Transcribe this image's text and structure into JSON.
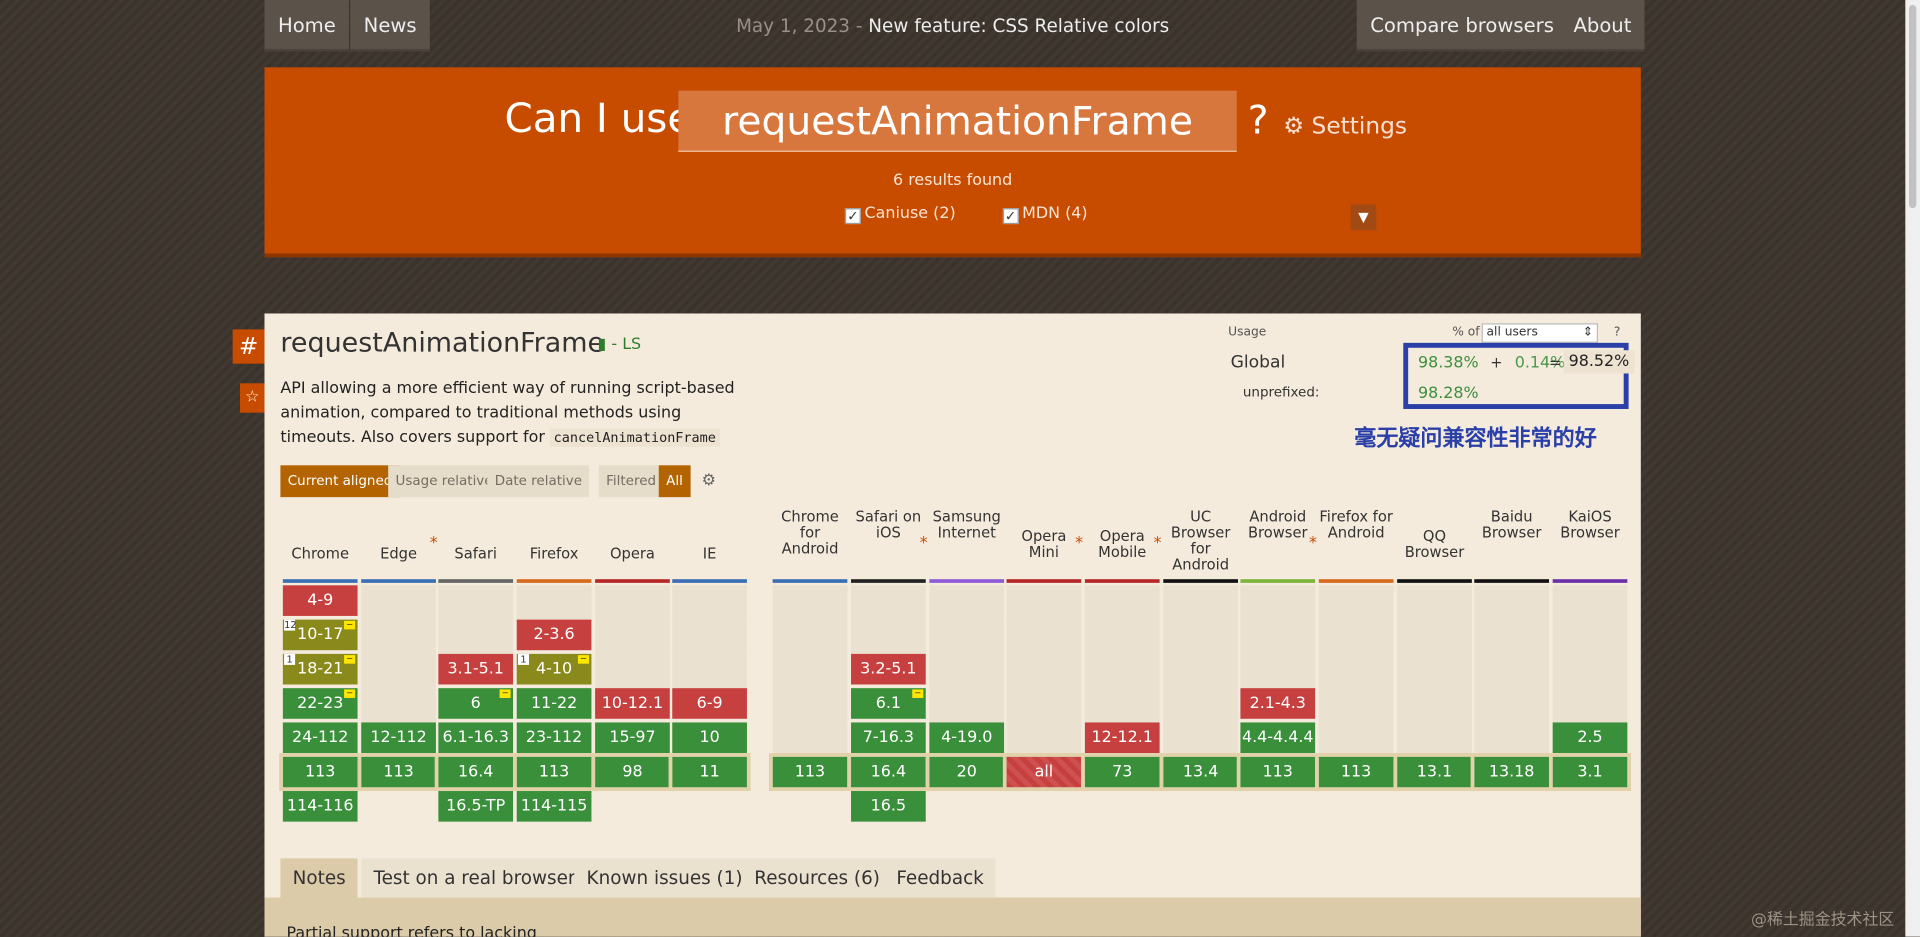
{
  "nav": {
    "home": "Home",
    "news": "News",
    "date": "May 1, 2023 - ",
    "announcement": "New feature: CSS Relative colors",
    "compare": "Compare browsers",
    "about": "About"
  },
  "search": {
    "prefix": "Can I use",
    "value": "requestAnimationFrame",
    "qmark": "?",
    "settings": "Settings",
    "results": "6 results found",
    "f1": "Caniuse (2)",
    "f2": "MDN (4)"
  },
  "feature": {
    "title": "requestAnimationFrame",
    "ls": "- LS",
    "desc": "API allowing a more efficient way of running script-based animation, compared to traditional methods using timeouts. Also covers support for ",
    "code": "cancelAnimationFrame"
  },
  "usage": {
    "label": "Usage",
    "pct_of": "% of",
    "users": "all users",
    "help": "?",
    "global": "Global",
    "unprefixed": "unprefixed:",
    "full": "98.38%",
    "plus": "+",
    "partial": "0.14%",
    "eq": "=",
    "total": "98.52%",
    "unpref": "98.28%"
  },
  "annotation": "毫无疑问兼容性非常的好",
  "toggles": {
    "current": "Current aligned",
    "usage": "Usage relative",
    "date": "Date relative",
    "filtered": "Filtered",
    "all": "All"
  },
  "desktop": [
    {
      "name": "Chrome",
      "color": "#3b6eb5",
      "cells": [
        "4-9",
        "10-17",
        "18-21",
        "22-23",
        "24-112",
        "113",
        "114-116"
      ]
    },
    {
      "name": "Edge",
      "ast": true,
      "color": "#3b6eb5",
      "cells": [
        "",
        "",
        "",
        "",
        "12-112",
        "113",
        ""
      ]
    },
    {
      "name": "Safari",
      "color": "#666666",
      "cells": [
        "",
        "",
        "3.1-5.1",
        "6",
        "6.1-16.3",
        "16.4",
        "16.5-TP"
      ]
    },
    {
      "name": "Firefox",
      "color": "#d86a1e",
      "cells": [
        "",
        "2-3.6",
        "4-10",
        "11-22",
        "23-112",
        "113",
        "114-115"
      ]
    },
    {
      "name": "Opera",
      "color": "#b52828",
      "cells": [
        "",
        "",
        "",
        "10-12.1",
        "15-97",
        "98",
        ""
      ]
    },
    {
      "name": "IE",
      "color": "#3b6eb5",
      "cells": [
        "",
        "",
        "",
        "6-9",
        "10",
        "11",
        ""
      ]
    }
  ],
  "mobile": [
    {
      "name": "Chrome for Android",
      "color": "#3b6eb5",
      "cells": [
        "",
        "",
        "",
        "",
        "",
        "113",
        ""
      ]
    },
    {
      "name": "Safari on iOS",
      "ast": true,
      "color": "#222222",
      "cells": [
        "",
        "",
        "3.2-5.1",
        "6.1",
        "7-16.3",
        "16.4",
        "16.5"
      ]
    },
    {
      "name": "Samsung Internet",
      "color": "#8f5ad6",
      "cells": [
        "",
        "",
        "",
        "",
        "4-19.0",
        "20",
        ""
      ]
    },
    {
      "name": "Opera Mini",
      "ast": true,
      "color": "#b52828",
      "cells": [
        "",
        "",
        "",
        "",
        "",
        "all",
        ""
      ]
    },
    {
      "name": "Opera Mobile",
      "ast": true,
      "color": "#b52828",
      "cells": [
        "",
        "",
        "",
        "",
        "12-12.1",
        "73",
        ""
      ]
    },
    {
      "name": "UC Browser for Android",
      "color": "#111111",
      "cells": [
        "",
        "",
        "",
        "",
        "",
        "13.4",
        ""
      ]
    },
    {
      "name": "Android Browser",
      "ast": true,
      "color": "#7db43c",
      "cells": [
        "",
        "",
        "",
        "2.1-4.3",
        "4.4-4.4.4",
        "113",
        ""
      ]
    },
    {
      "name": "Firefox for Android",
      "color": "#d86a1e",
      "cells": [
        "",
        "",
        "",
        "",
        "",
        "113",
        ""
      ]
    },
    {
      "name": "QQ Browser",
      "color": "#111111",
      "cells": [
        "",
        "",
        "",
        "",
        "",
        "13.1",
        ""
      ]
    },
    {
      "name": "Baidu Browser",
      "color": "#111111",
      "cells": [
        "",
        "",
        "",
        "",
        "",
        "13.18",
        ""
      ]
    },
    {
      "name": "KaiOS Browser",
      "color": "#6b2fa8",
      "cells": [
        "",
        "",
        "",
        "",
        "2.5",
        "3.1",
        ""
      ]
    }
  ],
  "tabs": [
    "Notes",
    "Test on a real browser",
    "Known issues (1)",
    "Resources (6)",
    "Feedback"
  ],
  "note": "Partial support refers to lacking",
  "watermark": "@稀土掘金技术社区"
}
